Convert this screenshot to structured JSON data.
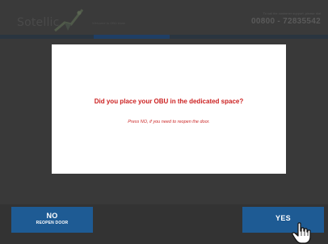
{
  "header": {
    "logo_text": "Sotellic",
    "tagline": "Welcome to OBU kiosk",
    "support_label": "To call the customer support, please dial",
    "support_phone": "00800 - 72835542"
  },
  "dialog": {
    "title": "Did you place your OBU in the dedicated space?",
    "subtitle": "Press NO, if you need to reopen the door."
  },
  "buttons": {
    "no_label": "NO",
    "no_sub_label": "REOPEN DOOR",
    "yes_label": "YES"
  },
  "colors": {
    "button_blue": "#1e5b94",
    "dialog_text_red": "#cc1f1f",
    "overlay": "#3d3d3d"
  }
}
